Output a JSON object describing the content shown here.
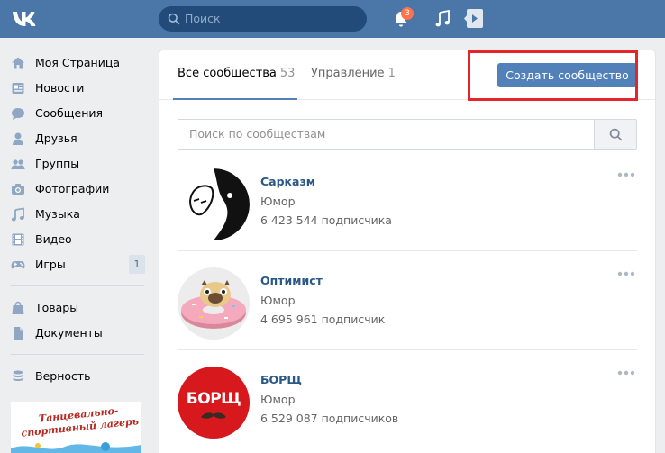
{
  "header": {
    "search_placeholder": "Поиск",
    "notifications_count": "3",
    "icons": [
      "vk-logo-icon",
      "search-icon",
      "bell-icon",
      "music-icon",
      "video-play-icon"
    ]
  },
  "sidebar": {
    "items": [
      {
        "label": "Моя Страница",
        "icon": "home-icon"
      },
      {
        "label": "Новости",
        "icon": "news-icon"
      },
      {
        "label": "Сообщения",
        "icon": "chat-icon"
      },
      {
        "label": "Друзья",
        "icon": "user-icon"
      },
      {
        "label": "Группы",
        "icon": "users-icon"
      },
      {
        "label": "Фотографии",
        "icon": "camera-icon"
      },
      {
        "label": "Музыка",
        "icon": "music-note-icon"
      },
      {
        "label": "Видео",
        "icon": "film-icon"
      },
      {
        "label": "Игры",
        "icon": "gamepad-icon",
        "count": "1"
      },
      {
        "label": "Товары",
        "icon": "bag-icon"
      },
      {
        "label": "Документы",
        "icon": "document-icon"
      },
      {
        "label": "Верность",
        "icon": "coins-icon"
      }
    ],
    "promo_text": "Танцевально-спортивный лагерь"
  },
  "main": {
    "tabs": [
      {
        "label": "Все сообщества",
        "count": "53"
      },
      {
        "label": "Управление",
        "count": "1"
      }
    ],
    "create_button": "Создать сообщество",
    "search_placeholder": "Поиск по сообществам",
    "groups": [
      {
        "name": "Сарказм",
        "category": "Юмор",
        "subscribers": "6 423 544 подписчика"
      },
      {
        "name": "Оптимист",
        "category": "Юмор",
        "subscribers": "4 695 961 подписчик"
      },
      {
        "name": "БОРЩ",
        "category": "Юмор",
        "subscribers": "6 529 087 подписчиков",
        "logo_text": "БОРЩ"
      }
    ]
  },
  "colors": {
    "header_bg": "#4a76a8",
    "accent": "#5181b8",
    "link": "#2a5885",
    "highlight_frame": "#e5252a",
    "page_bg": "#edeef0"
  }
}
